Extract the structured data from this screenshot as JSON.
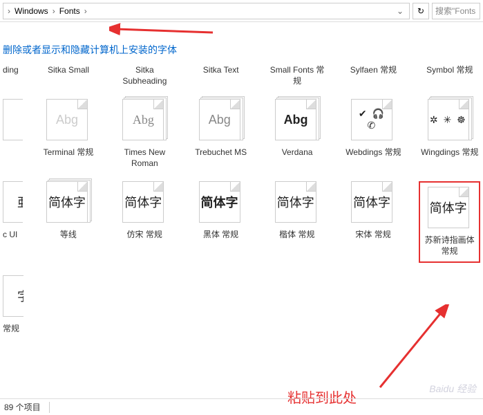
{
  "breadcrumb": {
    "item1": "Windows",
    "item2": "Fonts"
  },
  "search": {
    "placeholder": "搜索\"Fonts"
  },
  "instruction": "删除或者显示和隐藏计算机上安装的字体",
  "row1": [
    {
      "label": "ding"
    },
    {
      "label": "Sitka Small"
    },
    {
      "label": "Sitka Subheading"
    },
    {
      "label": "Sitka Text"
    },
    {
      "label": "Small Fonts 常规"
    },
    {
      "label": "Sylfaen 常规"
    },
    {
      "label": "Symbol 常规"
    }
  ],
  "row2": [
    {
      "sample": "",
      "label": ""
    },
    {
      "sample": "Abg",
      "label": "Terminal 常规",
      "style": "light"
    },
    {
      "sample": "Abg",
      "label": "Times New Roman",
      "style": "mid",
      "stack": true
    },
    {
      "sample": "Abg",
      "label": "Trebuchet MS",
      "style": "mid",
      "stack": true
    },
    {
      "sample": "Abg",
      "label": "Verdana",
      "style": "",
      "stack": true
    },
    {
      "sample": "✔ 🎧 ✆",
      "label": "Webdings 常规",
      "style": "sym"
    },
    {
      "sample": "✲ ✳ ☸",
      "label": "Wingdings 常规",
      "style": "sym",
      "stack": true
    }
  ],
  "row3": [
    {
      "sample": "亜",
      "label": "c UI",
      "cut": true
    },
    {
      "sample": "简体字",
      "label": "等线",
      "stack": true
    },
    {
      "sample": "简体字",
      "label": "仿宋 常规"
    },
    {
      "sample": "简体字",
      "label": "黑体 常规"
    },
    {
      "sample": "简体字",
      "label": "楷体 常规"
    },
    {
      "sample": "简体字",
      "label": "宋体 常规"
    },
    {
      "sample": "简体字",
      "label": "苏新诗指画体 常规",
      "highlight": true
    }
  ],
  "row4": [
    {
      "sample": "字",
      "label": "常规",
      "cut": true
    }
  ],
  "status": {
    "count": "89 个项目"
  },
  "annotation": "粘贴到此处",
  "watermark": "Baidu 经验"
}
